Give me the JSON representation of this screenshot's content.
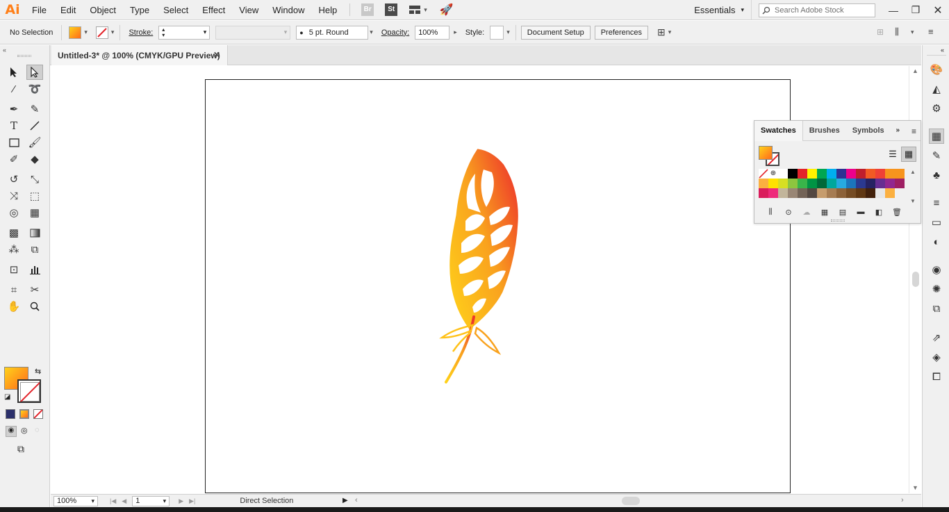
{
  "menubar": {
    "logo": "Ai",
    "items": [
      "File",
      "Edit",
      "Object",
      "Type",
      "Select",
      "Effect",
      "View",
      "Window",
      "Help"
    ],
    "bridge": "Br",
    "stock": "St",
    "workspace": "Essentials",
    "search_placeholder": "Search Adobe Stock"
  },
  "controlbar": {
    "selection": "No Selection",
    "stroke_label": "Stroke:",
    "brush": "5 pt. Round",
    "opacity_label": "Opacity:",
    "opacity_value": "100%",
    "style_label": "Style:",
    "document_setup": "Document Setup",
    "preferences": "Preferences"
  },
  "document": {
    "tab_title": "Untitled-3* @ 100% (CMYK/GPU Preview)"
  },
  "statusbar": {
    "zoom": "100%",
    "artboard": "1",
    "tool": "Direct Selection"
  },
  "swatches": {
    "tabs": [
      "Swatches",
      "Brushes",
      "Symbols"
    ],
    "colors": [
      "#ffffff",
      "#000000",
      "#e3232a",
      "#fff200",
      "#00a651",
      "#00aeef",
      "#2e3192",
      "#ec008c",
      "#be1e2d",
      "#f15a24",
      "#ef4136",
      "#f7941d",
      "#f7941d",
      "#fbb040",
      "#ffe200",
      "#d7df23",
      "#8dc63f",
      "#39b54a",
      "#009444",
      "#006838",
      "#00a79d",
      "#27aae1",
      "#1c75bc",
      "#2b3990",
      "#262262",
      "#662d91",
      "#92278f",
      "#9e1f63",
      "#da1c5c",
      "#ee2a7b",
      "#c2b59b",
      "#998675",
      "#736357",
      "#534741",
      "#c69c6d",
      "#a67c52",
      "#8c6239",
      "#754c24",
      "#603813",
      "#42210b",
      "#e6e6e6",
      "#fbb040"
    ]
  },
  "colors": {
    "accent": "#ff7f18",
    "fill_start": "#ffd21a",
    "fill_end": "#ff6a1a",
    "none_red": "#e3232a"
  }
}
